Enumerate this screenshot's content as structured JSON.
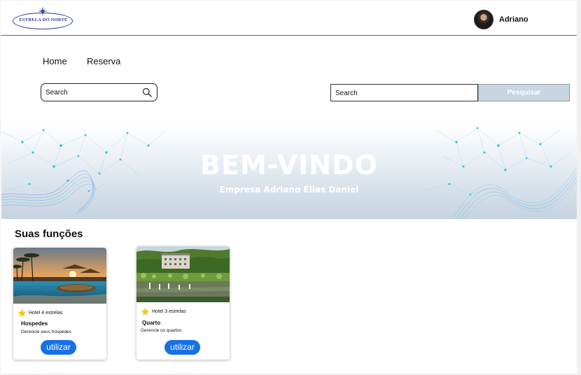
{
  "header": {
    "logo_text": "ESTRELA DO NORTE",
    "user_name": "Adriano"
  },
  "nav": {
    "items": [
      {
        "label": "Home"
      },
      {
        "label": "Reserva"
      }
    ]
  },
  "search_left": {
    "placeholder": "Search"
  },
  "search_right": {
    "placeholder": "Search",
    "button_label": "Pesquisar"
  },
  "banner": {
    "title": "BEM-VINDO",
    "subtitle": "Empresa Adriano Elias Daniel"
  },
  "functions": {
    "title": "Suas funções",
    "cards": [
      {
        "rating": "Hotel 4 estrelas",
        "name": "Hospedes",
        "description": "Gerencie seus hospedes",
        "button": "utilizar"
      },
      {
        "rating": "Hotel 3 estrelas",
        "name": "Quarto",
        "description": "Gerencie os quartos",
        "button": "utilizar"
      }
    ]
  },
  "colors": {
    "accent": "#1671e6",
    "star": "#f5c518",
    "search_button": "#c8d6e2"
  }
}
